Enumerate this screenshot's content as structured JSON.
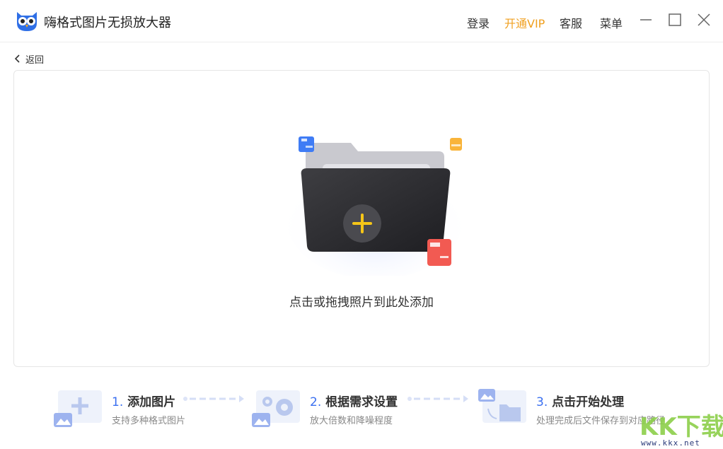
{
  "app": {
    "title": "嗨格式图片无损放大器"
  },
  "titlebar": {
    "login": "登录",
    "vip": "开通VIP",
    "service": "客服",
    "menu": "菜单",
    "vip_color": "#f0a020"
  },
  "nav": {
    "back_label": "返回"
  },
  "dropzone": {
    "text": "点击或拖拽照片到此处添加"
  },
  "steps": [
    {
      "number": "1.",
      "title": "添加图片",
      "desc": "支持多种格式图片"
    },
    {
      "number": "2.",
      "title": "根据需求设置",
      "desc": "放大倍数和降噪程度"
    },
    {
      "number": "3.",
      "title": "点击开始处理",
      "desc": "处理完成后文件保存到对应路径"
    }
  ],
  "watermark": {
    "text": "KK下载",
    "url": "www.kkx.net"
  },
  "colors": {
    "accent": "#3a6ff0",
    "plus": "#f5c518",
    "folder": "#2f2f33"
  }
}
